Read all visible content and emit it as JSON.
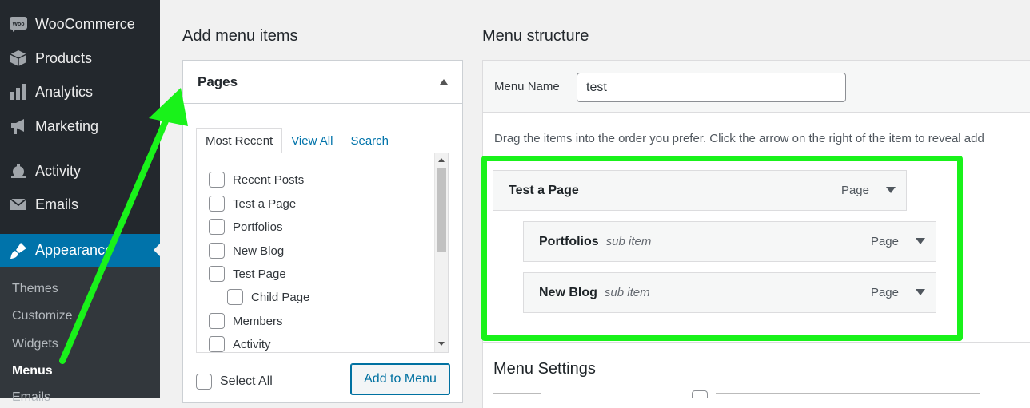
{
  "sidebar": {
    "items": [
      {
        "label": "WooCommerce",
        "icon": "woo-icon"
      },
      {
        "label": "Products",
        "icon": "box-icon"
      },
      {
        "label": "Analytics",
        "icon": "bar-chart-icon"
      },
      {
        "label": "Marketing",
        "icon": "megaphone-icon"
      },
      {
        "label": "Activity",
        "icon": "activity-icon"
      },
      {
        "label": "Emails",
        "icon": "envelope-icon"
      },
      {
        "label": "Appearance",
        "icon": "paintbrush-icon"
      }
    ],
    "submenu": [
      "Themes",
      "Customize",
      "Widgets",
      "Menus",
      "Emails"
    ],
    "current_submenu": "Menus"
  },
  "add_menu_items": {
    "heading": "Add menu items",
    "box_title": "Pages",
    "tabs": [
      "Most Recent",
      "View All",
      "Search"
    ],
    "active_tab": "Most Recent",
    "pages": [
      {
        "label": "Recent Posts"
      },
      {
        "label": "Test a Page"
      },
      {
        "label": "Portfolios"
      },
      {
        "label": "New Blog"
      },
      {
        "label": "Test Page"
      },
      {
        "label": "Child Page"
      },
      {
        "label": "Members"
      },
      {
        "label": "Activity"
      }
    ],
    "select_all": "Select All",
    "add_button": "Add to Menu"
  },
  "menu_structure": {
    "heading": "Menu structure",
    "menu_name_label": "Menu Name",
    "menu_name_value": "test",
    "instructions": "Drag the items into the order you prefer. Click the arrow on the right of the item to reveal add",
    "items": [
      {
        "title": "Test a Page",
        "sub": "",
        "type": "Page"
      },
      {
        "title": "Portfolios",
        "sub": "sub item",
        "type": "Page"
      },
      {
        "title": "New Blog",
        "sub": "sub item",
        "type": "Page"
      }
    ],
    "settings_heading": "Menu Settings"
  },
  "colors": {
    "sidebar_bg": "#23282d",
    "active_blue": "#0073aa",
    "highlight_green": "#19f21a"
  }
}
